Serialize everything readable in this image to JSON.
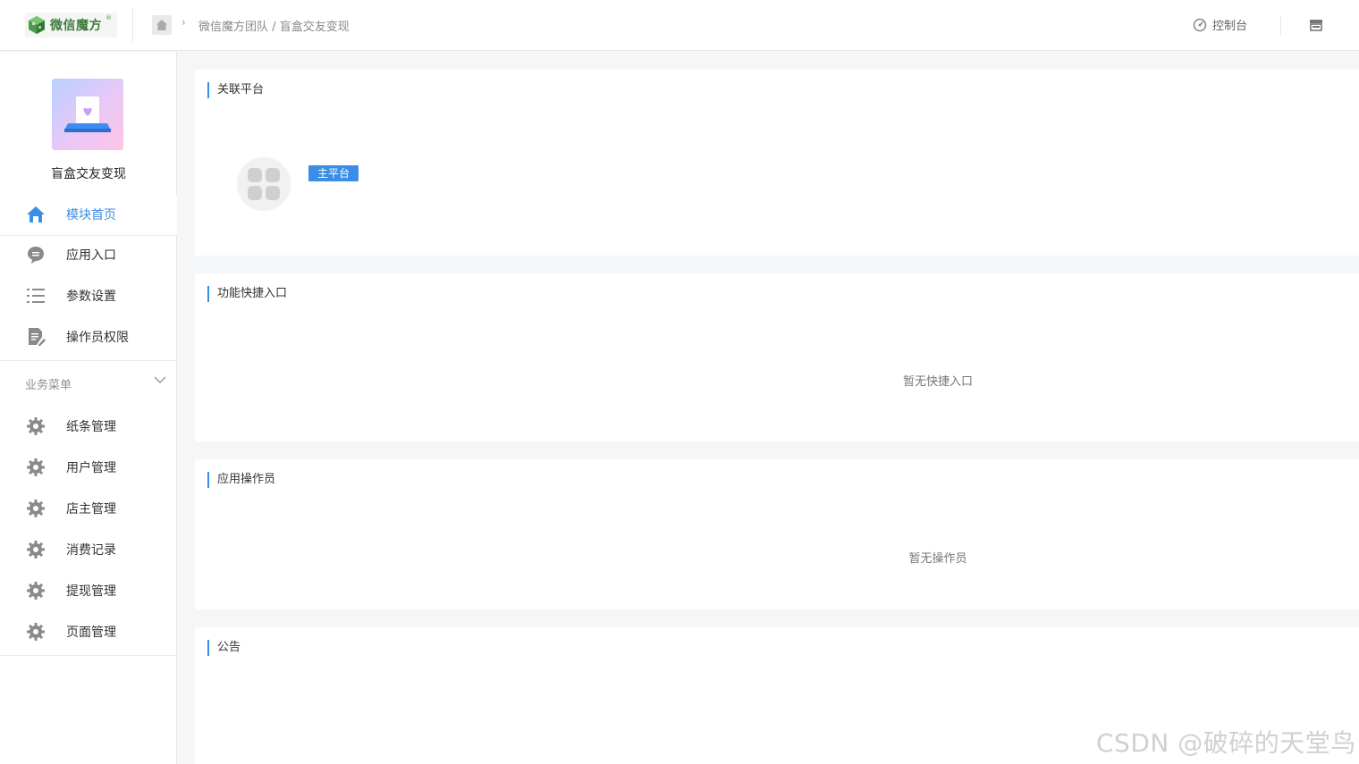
{
  "header": {
    "logo_text": "微信魔方",
    "logo_mark": "®",
    "breadcrumb_team": "微信魔方团队",
    "breadcrumb_sep": "/",
    "breadcrumb_app": "盲盒交友变现",
    "console_label": "控制台"
  },
  "sidebar": {
    "app_name": "盲盒交友变现",
    "items": [
      {
        "label": "模块首页",
        "icon": "home-icon",
        "active": true
      },
      {
        "label": "应用入口",
        "icon": "chat-bubble-icon"
      },
      {
        "label": "参数设置",
        "icon": "list-settings-icon"
      },
      {
        "label": "操作员权限",
        "icon": "document-edit-icon"
      }
    ],
    "group_title": "业务菜单",
    "group_items": [
      {
        "label": "纸条管理",
        "icon": "gear-icon"
      },
      {
        "label": "用户管理",
        "icon": "gear-icon"
      },
      {
        "label": "店主管理",
        "icon": "gear-icon"
      },
      {
        "label": "消费记录",
        "icon": "gear-icon"
      },
      {
        "label": "提现管理",
        "icon": "gear-icon"
      },
      {
        "label": "页面管理",
        "icon": "gear-icon"
      }
    ]
  },
  "main": {
    "linked_platform": {
      "title": "关联平台",
      "badge": "主平台"
    },
    "shortcuts": {
      "title": "功能快捷入口",
      "empty": "暂无快捷入口"
    },
    "operators": {
      "title": "应用操作员",
      "empty": "暂无操作员"
    },
    "notice": {
      "title": "公告"
    }
  },
  "watermark": "CSDN @破碎的天堂鸟",
  "colors": {
    "accent": "#3a8ee6",
    "logo_green": "#3b7a3a"
  }
}
